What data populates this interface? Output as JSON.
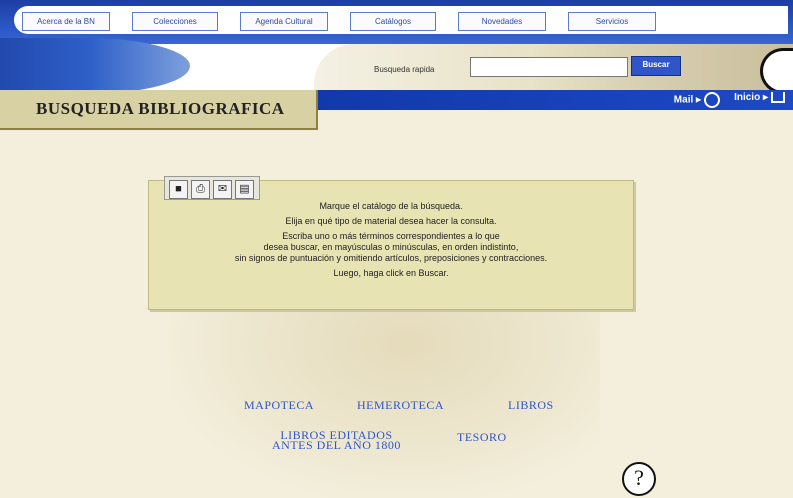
{
  "nav": {
    "items": [
      {
        "label": "Acerca de la BN"
      },
      {
        "label": "Colecciones"
      },
      {
        "label": "Agenda Cultural"
      },
      {
        "label": "Catálogos"
      },
      {
        "label": "Novedades"
      },
      {
        "label": "Servicios"
      }
    ]
  },
  "search": {
    "label": "Busqueda rapida",
    "value": "",
    "button_label": "Buscar"
  },
  "utility": {
    "mail_label": "Mail",
    "home_label": "Inicio"
  },
  "page": {
    "title": "BUSQUEDA BIBLIOGRAFICA"
  },
  "toolbar": {
    "icons": [
      "save-icon",
      "print-icon",
      "mail-icon",
      "document-icon"
    ]
  },
  "instructions": {
    "line1": "Marque el catálogo de la búsqueda.",
    "line2": "Elija en qué tipo de material desea hacer la consulta.",
    "line3a": "Escriba uno o más términos correspondientes a lo que",
    "line3b": "desea buscar, en mayúsculas o minúsculas, en orden indistinto,",
    "line3c": "sin signos de puntuación y omitiendo artículos, preposiciones y contracciones.",
    "line4": "Luego, haga click en Buscar."
  },
  "catalogs": {
    "mapoteca": "MAPOTECA",
    "hemeroteca": "HEMEROTECA",
    "libros": "LIBROS",
    "libros_editados_1": "LIBROS EDITADOS",
    "libros_editados_2": "ANTES DEL AÑO 1800",
    "tesoro": "TESORO"
  },
  "help": {
    "symbol": "?"
  },
  "colors": {
    "nav_blue": "#1d49c4",
    "link_blue": "#2f55c8",
    "banner_tan": "#d8d1a4",
    "box_bg": "#e7e3b3"
  }
}
